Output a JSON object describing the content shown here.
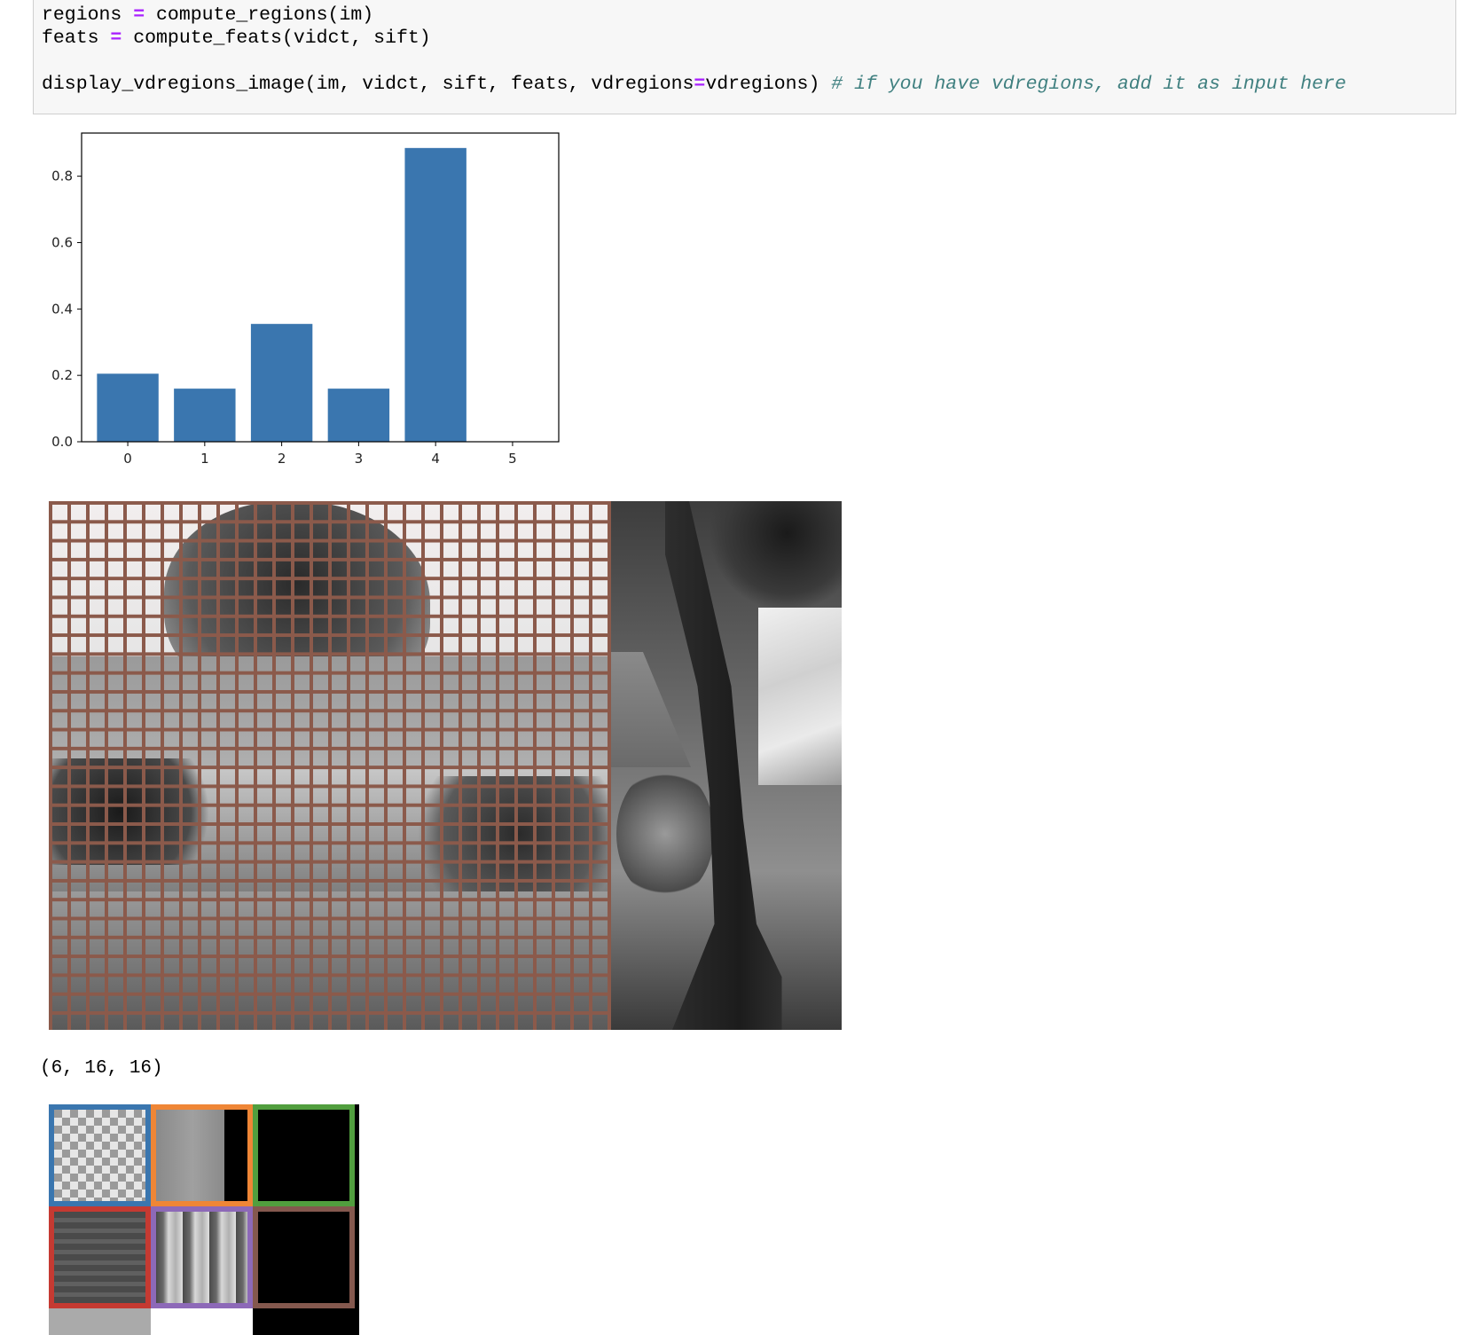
{
  "code": {
    "line1": {
      "a": "regions ",
      "op": "=",
      "b": " compute_regions(im)"
    },
    "line2": {
      "a": "feats ",
      "op": "=",
      "b": " compute_feats(vidct, sift)"
    },
    "line3": {
      "a": "display_vdregions_image(im, vidct, sift, feats, vdregions",
      "op": "=",
      "b": "vdregions) ",
      "comment": "# if you have vdregions, add it as input here"
    }
  },
  "chart_data": {
    "type": "bar",
    "categories": [
      "0",
      "1",
      "2",
      "3",
      "4",
      "5"
    ],
    "values": [
      0.205,
      0.16,
      0.355,
      0.16,
      0.885,
      0.0
    ],
    "title": "",
    "xlabel": "",
    "ylabel": "",
    "ylim": [
      0,
      0.93
    ],
    "yticks": [
      "0.0",
      "0.2",
      "0.4",
      "0.6",
      "0.8"
    ],
    "bar_color": "#3a76af",
    "grid": false
  },
  "output_shape": "(6, 16, 16)",
  "colors": {
    "grid_line": "#8b5a4b",
    "patch_borders": [
      "#3a76af",
      "#ef8636",
      "#519e3e",
      "#c53a32",
      "#8d69b8",
      "#84584e"
    ]
  }
}
